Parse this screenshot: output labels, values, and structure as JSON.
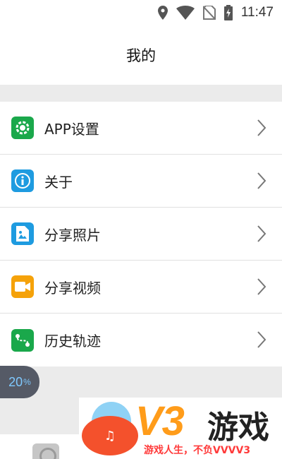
{
  "status_bar": {
    "time": "11:47",
    "icons": [
      "location-pin-icon",
      "wifi-icon",
      "no-sim-icon",
      "battery-charging-icon"
    ]
  },
  "header": {
    "title": "我的"
  },
  "menu": {
    "items": [
      {
        "label": "APP设置",
        "icon": "gear-icon",
        "color": "#1aa84b"
      },
      {
        "label": "关于",
        "icon": "info-icon",
        "color": "#1e9be0"
      },
      {
        "label": "分享照片",
        "icon": "photo-icon",
        "color": "#1e9be0"
      },
      {
        "label": "分享视频",
        "icon": "video-icon",
        "color": "#f5a20a"
      },
      {
        "label": "历史轨迹",
        "icon": "route-icon",
        "color": "#1aa84b"
      }
    ]
  },
  "floating_badge": {
    "value": "20",
    "unit": "%"
  },
  "watermark": {
    "brand": "V3",
    "name": "游戏",
    "slogan": "游戏人生，不负VVVV3"
  }
}
